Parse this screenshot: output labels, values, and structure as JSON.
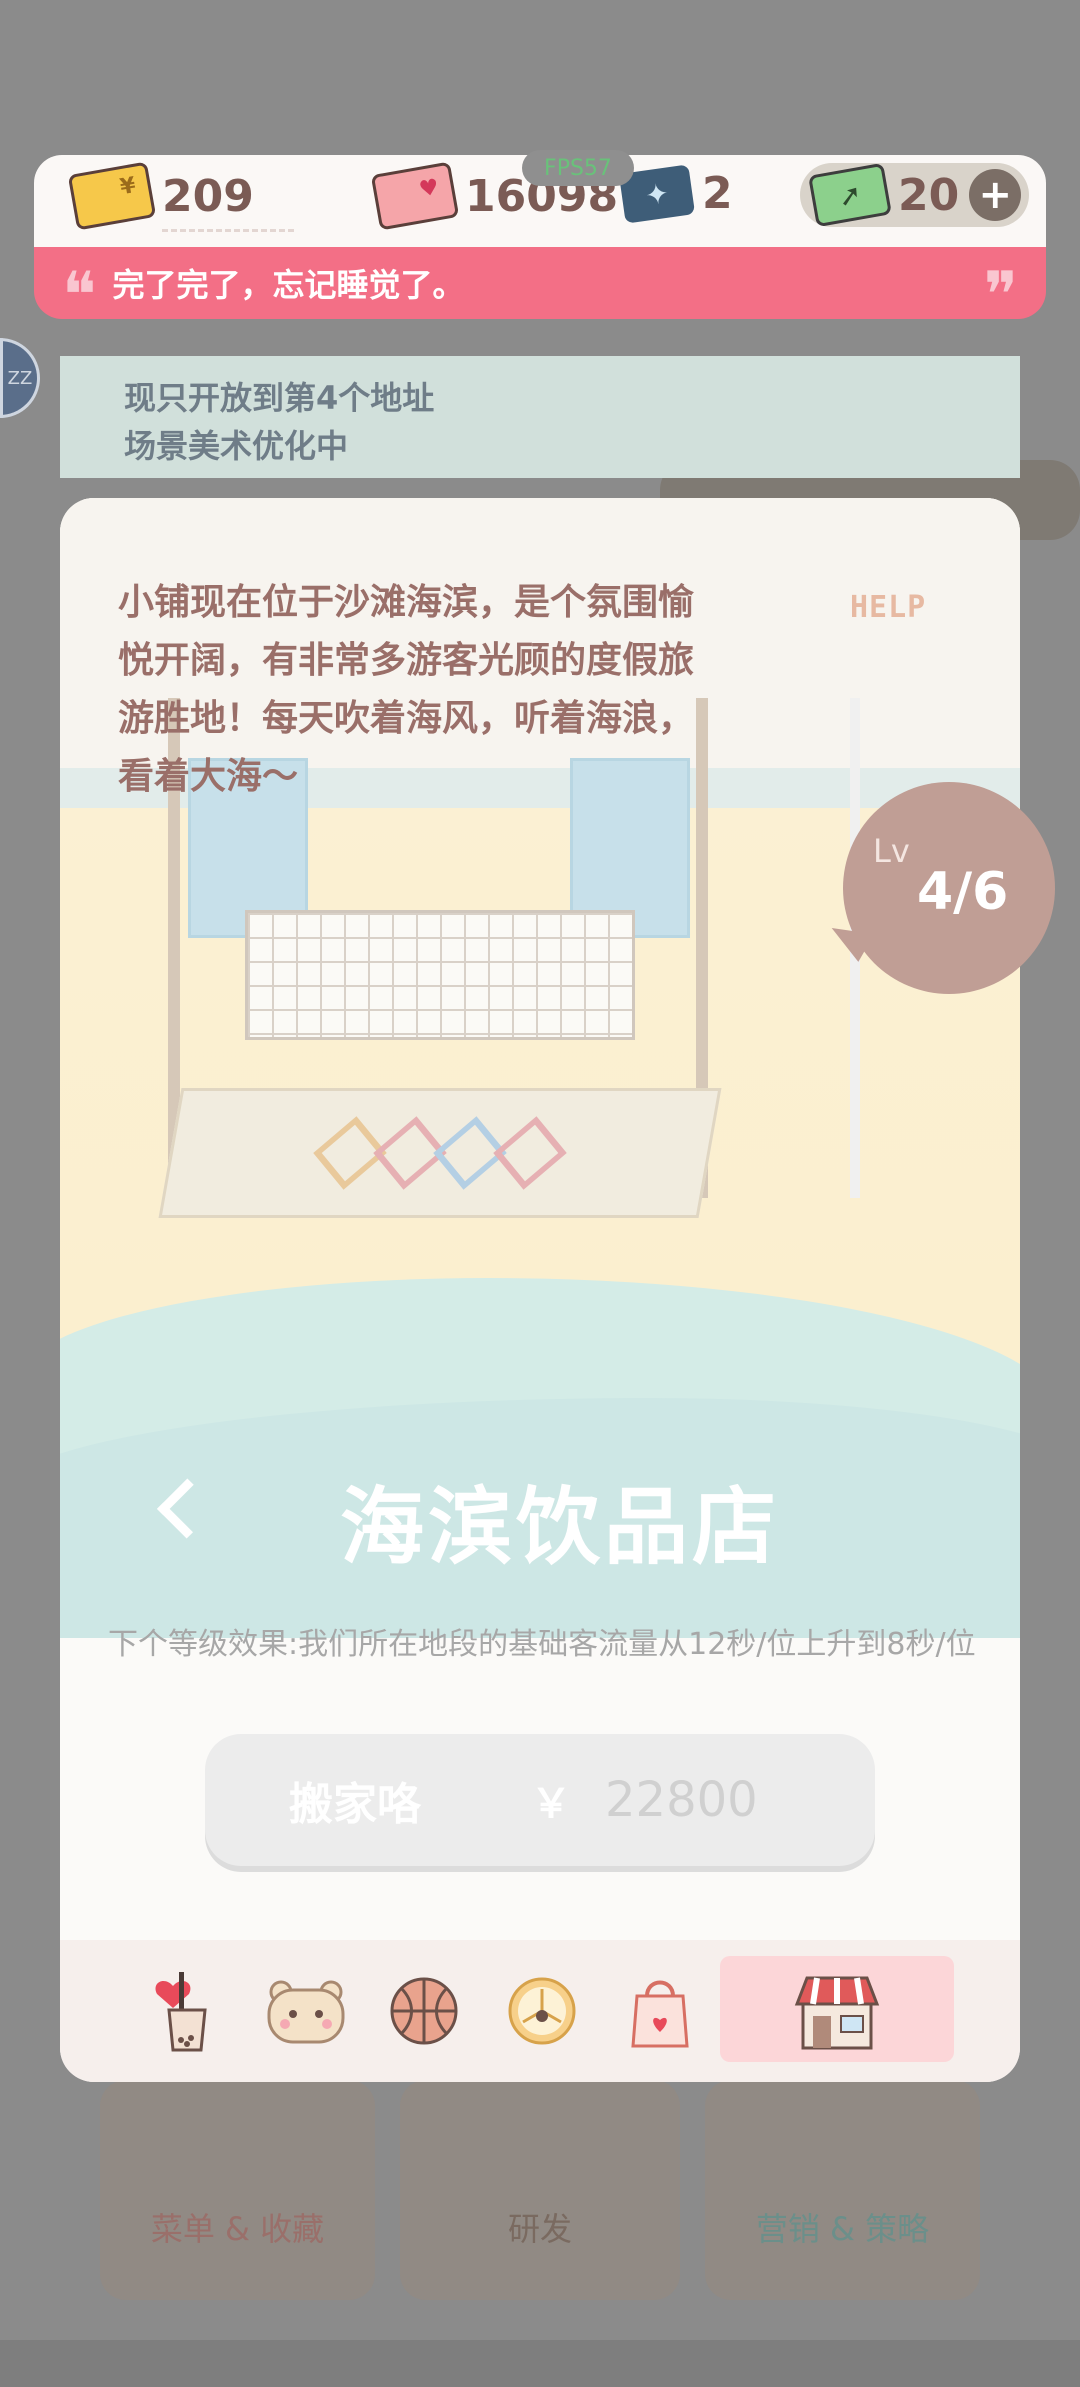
{
  "fps": "FPS57",
  "resources": {
    "gold_cards": "209",
    "heart_cards": "16098",
    "tickets": "2",
    "green_tickets": "20",
    "add_symbol": "+"
  },
  "quote": {
    "open": "❝",
    "text": "完了完了，忘记睡觉了。",
    "close": "❞"
  },
  "sleep_badge": "ZZ",
  "notice": {
    "line1": "现只开放到第4个地址",
    "line2": "场景美术优化中"
  },
  "panel": {
    "story": "小铺现在位于沙滩海滨，是个氛围愉悦开阔，有非常多游客光顾的度假旅游胜地！每天吹着海风，听着海浪，看着大海～",
    "help": "HELP",
    "store_name": "海滨饮品店",
    "next_level_effect": "下个等级效果:我们所在地段的基础客流量从12秒/位上升到8秒/位",
    "move_button": {
      "label": "搬家咯",
      "currency": "￥",
      "price": "22800"
    }
  },
  "level": {
    "prefix": "Lv",
    "value": "4/6"
  },
  "background_buttons": {
    "menu": "菜单 & 收藏",
    "research": "研发",
    "marketing": "营销 & 策略"
  },
  "tabs": [
    "drink-icon",
    "bear-icon",
    "basketball-icon",
    "orange-slice-icon",
    "bag-icon",
    "shop-icon"
  ],
  "colors": {
    "accent_pink": "#f36f86",
    "level_badge": "#c09e95",
    "notice_bg": "#d1e0db"
  }
}
